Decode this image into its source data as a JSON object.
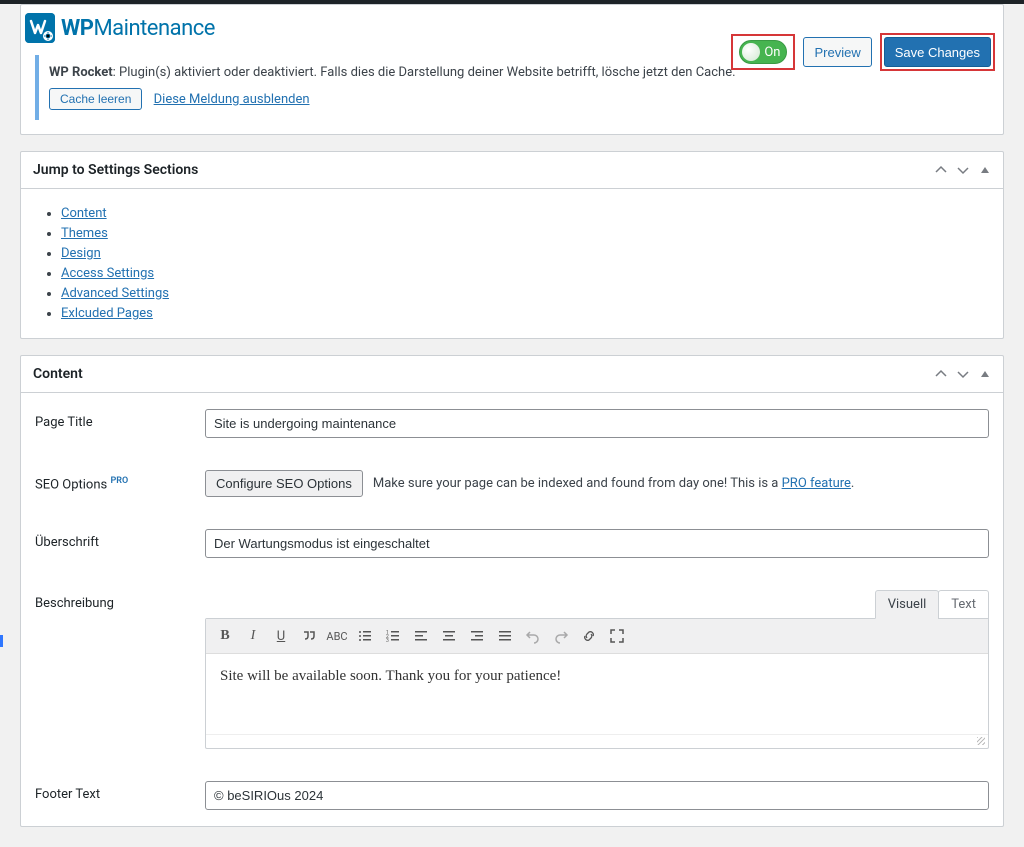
{
  "brand": {
    "wp": "WP",
    "maint": "Maintenance"
  },
  "header": {
    "toggle_label": "On",
    "preview_label": "Preview",
    "save_label": "Save Changes"
  },
  "notice": {
    "prefix": "WP Rocket",
    "message": ": Plugin(s) aktiviert oder deaktiviert. Falls dies die Darstellung deiner Website betrifft, lösche jetzt den Cache.",
    "clear_cache_label": "Cache leeren",
    "dismiss_label": "Diese Meldung ausblenden"
  },
  "jump": {
    "title": "Jump to Settings Sections",
    "items": [
      "Content",
      "Themes",
      "Design",
      "Access Settings",
      "Advanced Settings",
      "Exlcuded Pages"
    ]
  },
  "content_section": {
    "title": "Content",
    "page_title_label": "Page Title",
    "page_title_value": "Site is undergoing maintenance",
    "seo_label": "SEO Options",
    "seo_pro": "PRO",
    "seo_button": "Configure SEO Options",
    "seo_help_1": "Make sure your page can be indexed and found from day one! This is a ",
    "seo_help_link": "PRO feature",
    "seo_help_2": ".",
    "headline_label": "Überschrift",
    "headline_value": "Der Wartungsmodus ist eingeschaltet",
    "description_label": "Beschreibung",
    "editor_tabs": {
      "visual": "Visuell",
      "text": "Text"
    },
    "editor_content": "Site will be available soon. Thank you for your patience!",
    "footer_label": "Footer Text",
    "footer_value": "© beSIRIOus 2024"
  }
}
